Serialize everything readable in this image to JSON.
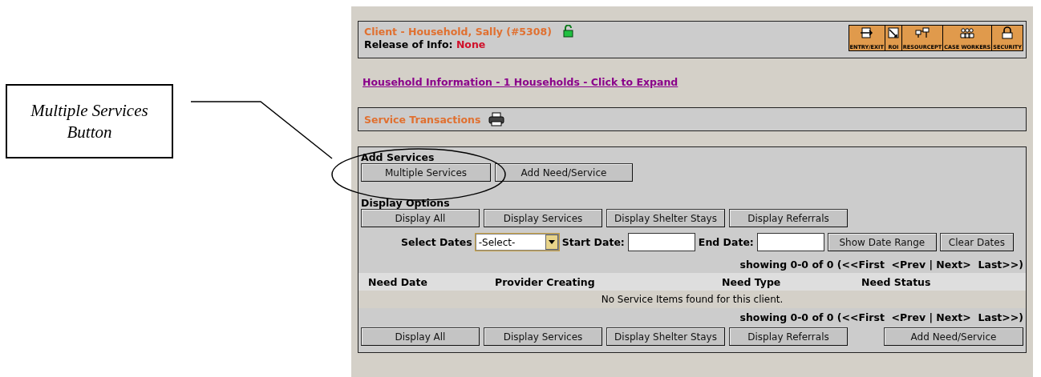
{
  "annotation": {
    "text": "Multiple Services Button"
  },
  "client": {
    "title": "Client - Household, Sally (#5308)",
    "release_label": "Release of Info:",
    "release_value": "None"
  },
  "toolbar": [
    {
      "label": "ENTRY/EXIT",
      "kind": "entry"
    },
    {
      "label": "ROI",
      "kind": "roi"
    },
    {
      "label": "RESOURCEPT",
      "kind": "resource"
    },
    {
      "label": "CASE WORKERS",
      "kind": "workers"
    },
    {
      "label": "SECURITY",
      "kind": "security"
    }
  ],
  "household_link": "Household Information - 1 Households - Click to Expand",
  "service_transactions": {
    "title": "Service Transactions"
  },
  "add_services": {
    "title": "Add Services",
    "buttons": [
      "Multiple Services",
      "Add Need/Service"
    ]
  },
  "display_options": {
    "title": "Display Options",
    "buttons": [
      "Display All",
      "Display Services",
      "Display Shelter Stays",
      "Display Referrals"
    ]
  },
  "date_filter": {
    "select_label": "Select Dates",
    "select_value": "-Select-",
    "start_label": "Start Date:",
    "end_label": "End Date:",
    "buttons": [
      "Show Date Range",
      "Clear Dates"
    ]
  },
  "pager_top": {
    "summary": "showing 0-0 of 0 (",
    "links": [
      "<<First",
      "<Prev",
      "Next>",
      "Last>>"
    ],
    "separator": "|",
    "close": ")"
  },
  "table": {
    "columns": [
      "Need Date",
      "Provider Creating",
      "Need Type",
      "Need Status"
    ],
    "empty_message": "No Service Items found for this client."
  },
  "pager_bottom": {
    "summary": "showing 0-0 of 0 (",
    "links": [
      "<<First",
      "<Prev",
      "Next>",
      "Last>>"
    ],
    "separator": "|",
    "close": ")"
  },
  "bottom_buttons": [
    "Display All",
    "Display Services",
    "Display Shelter Stays",
    "Display Referrals"
  ],
  "bottom_action": "Add Need/Service"
}
